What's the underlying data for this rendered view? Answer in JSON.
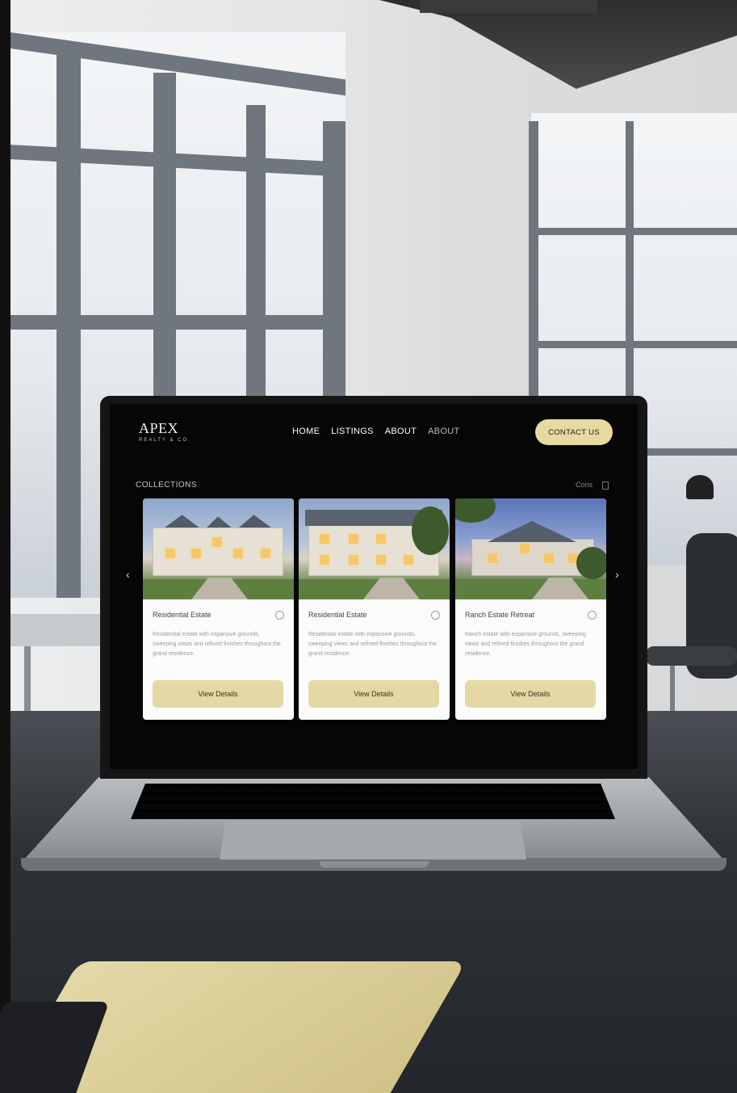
{
  "site": {
    "logo": "APEX",
    "logo_tagline": "REALTY & CO.",
    "nav": [
      "HOME",
      "LISTINGS",
      "ABOUT",
      "ABOUT"
    ],
    "contact_label": "CONTACT US",
    "section_title": "COLLECTIONS",
    "section_right": "Cons",
    "prev_arrow": "‹",
    "next_arrow": "›"
  },
  "cards": [
    {
      "title": "Residential Estate",
      "description": "Residential estate with expansive grounds, sweeping views and refined finishes throughout the grand residence.",
      "button": "View Details"
    },
    {
      "title": "Residential Estate",
      "description": "Residential estate with expansive grounds, sweeping views and refined finishes throughout the grand residence.",
      "button": "View Details"
    },
    {
      "title": "Ranch Estate Retreat",
      "description": "Ranch estate with expansive grounds, sweeping views and refined finishes throughout the grand residence.",
      "button": "View Details"
    }
  ],
  "colors": {
    "accent": "#e6d9a2",
    "screen_bg": "#060606",
    "card_bg": "#fbfbfb"
  },
  "icons": [
    "chevron-left-icon",
    "chevron-right-icon",
    "info-icon",
    "list-icon"
  ]
}
